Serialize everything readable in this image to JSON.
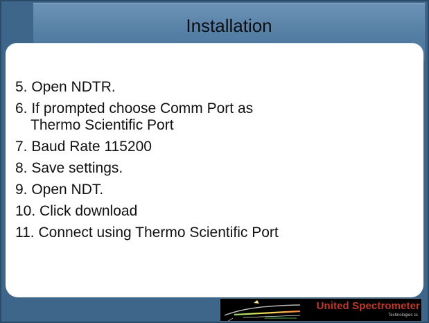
{
  "slide": {
    "title": "Installation",
    "steps": [
      "5. Open NDTR.",
      "6. If prompted choose Comm Port as",
      "Thermo Scientific Port",
      "7. Baud Rate 115200",
      "8. Save settings.",
      "9. Open NDT.",
      "10. Click download",
      "11. Connect using Thermo Scientific Port"
    ]
  },
  "branding": {
    "company_name": "United Spectrometer",
    "company_subtitle": "Technologies cc"
  },
  "theme": {
    "frame_color": "#3e668a",
    "header_color": "#5f86ab",
    "logo_red": "#c0392b"
  }
}
